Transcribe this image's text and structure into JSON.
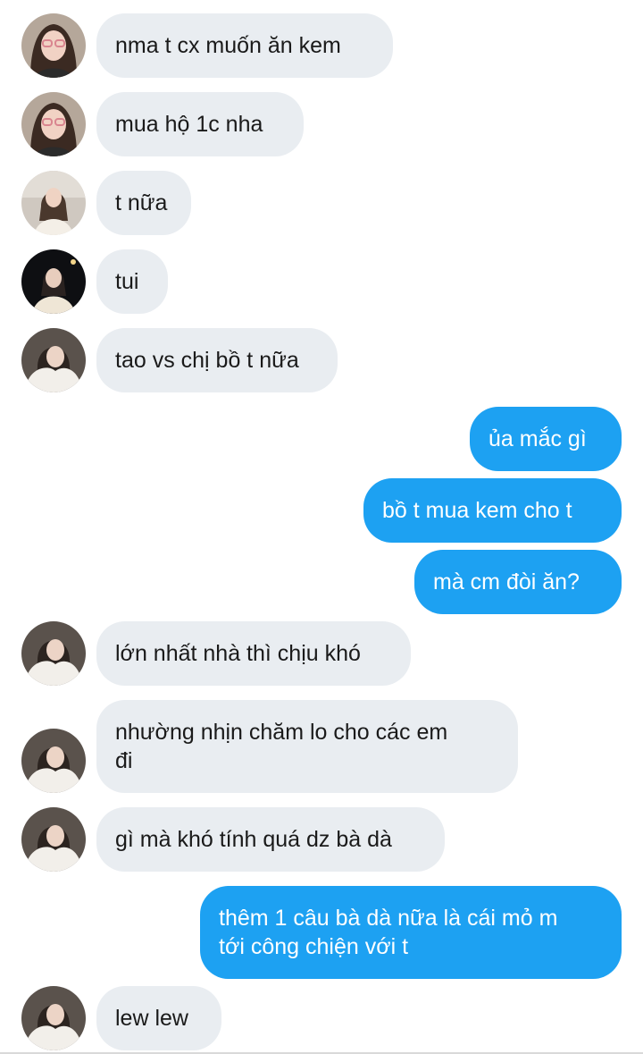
{
  "conversation": {
    "messages": [
      {
        "sender": "other",
        "text": "nma t cx muốn ăn kem",
        "avatar": "avatar-user-a"
      },
      {
        "sender": "other",
        "text": "mua hộ 1c nha",
        "avatar": "avatar-user-a"
      },
      {
        "sender": "other",
        "text": "t nữa",
        "avatar": "avatar-user-b"
      },
      {
        "sender": "other",
        "text": "tui",
        "avatar": "avatar-user-c"
      },
      {
        "sender": "other",
        "text": "tao vs chị bồ t nữa",
        "avatar": "avatar-user-d"
      },
      {
        "sender": "me",
        "text": "ủa mắc gì"
      },
      {
        "sender": "me",
        "text": "bồ t mua kem cho t"
      },
      {
        "sender": "me",
        "text": "mà cm đòi ăn?"
      },
      {
        "sender": "other",
        "text": "lớn nhất nhà thì chịu khó",
        "avatar": "avatar-user-d"
      },
      {
        "sender": "other",
        "text": "nhường nhịn chăm lo cho các em\nđi",
        "avatar": "avatar-user-d"
      },
      {
        "sender": "other",
        "text": "gì mà khó tính quá dz bà dà",
        "avatar": "avatar-user-d"
      },
      {
        "sender": "me",
        "text": "thêm 1 câu bà dà nữa là cái mỏ m\ntới công chiện với t"
      },
      {
        "sender": "other",
        "text": "lew lew",
        "avatar": "avatar-user-d"
      }
    ]
  },
  "colors": {
    "incoming_bubble": "#e9edf1",
    "outgoing_bubble": "#1da1f2",
    "incoming_text": "#1a1a1a",
    "outgoing_text": "#ffffff"
  }
}
